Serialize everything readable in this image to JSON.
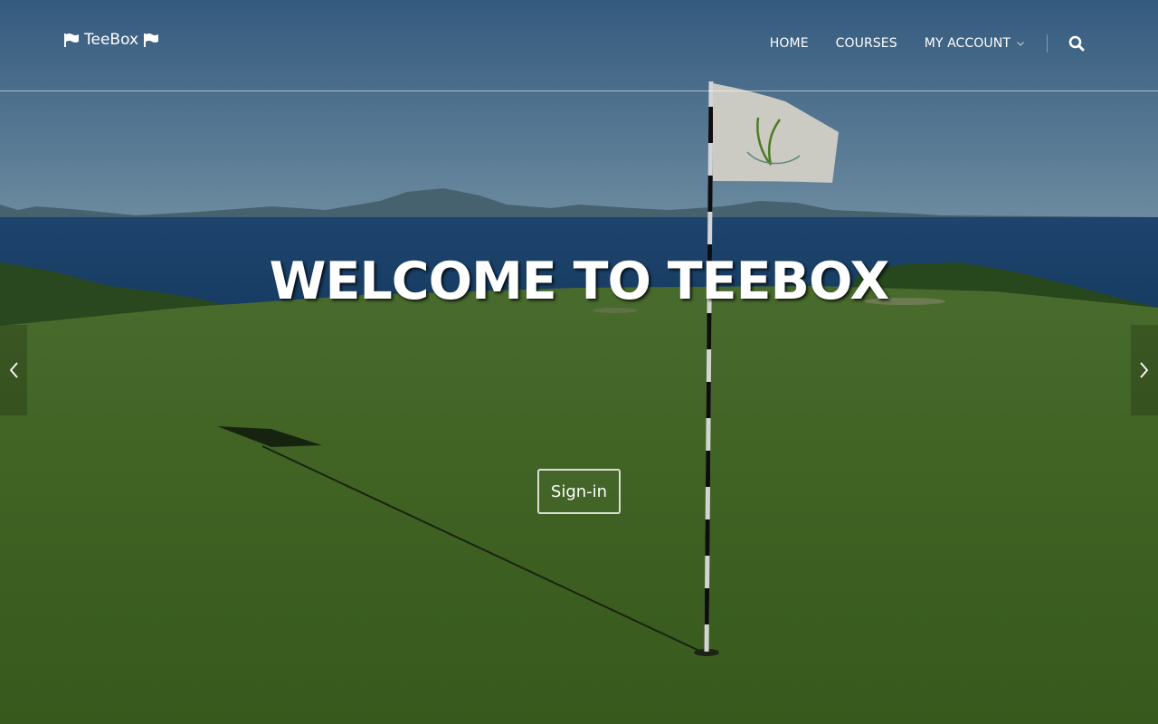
{
  "brand": {
    "name": "TeeBox",
    "icon_left": "flag-icon",
    "icon_right": "flag-icon"
  },
  "nav": {
    "items": [
      {
        "label": "HOME"
      },
      {
        "label": "COURSES"
      },
      {
        "label": "MY ACCOUNT",
        "icon": "chevron-down-icon"
      }
    ],
    "search_icon": "search-icon"
  },
  "hero": {
    "headline": "WELCOME TO TEEBOX",
    "signin_label": "Sign-in",
    "prev_icon": "chevron-left-icon",
    "next_icon": "chevron-right-icon"
  },
  "colors": {
    "sky": "#3f6a8f",
    "sea": "#1f4e7a",
    "grass": "#4b7028",
    "text": "#ffffff"
  }
}
